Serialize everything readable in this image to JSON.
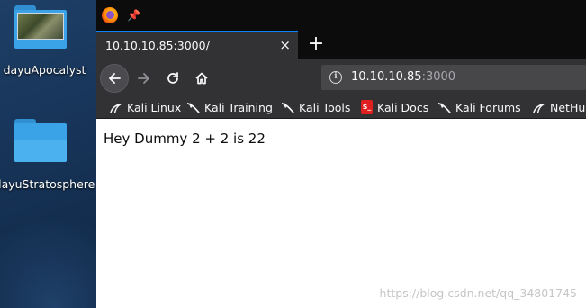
{
  "desktop": {
    "icons": [
      {
        "label": "dayuApocalyst"
      },
      {
        "label": "dayuStratosphere"
      }
    ]
  },
  "browser": {
    "tab": {
      "title": "10.10.10.85:3000/",
      "close_glyph": "×"
    },
    "new_tab_glyph": "+",
    "address": {
      "host": "10.10.10.85",
      "port": ":3000"
    },
    "bookmarks": [
      {
        "label": "Kali Linux",
        "icon": "kali-dragon-icon"
      },
      {
        "label": "Kali Training",
        "icon": "kali-dragon-icon"
      },
      {
        "label": "Kali Tools",
        "icon": "kali-dragon-icon"
      },
      {
        "label": "Kali Docs",
        "icon": "kali-docs-icon"
      },
      {
        "label": "Kali Forums",
        "icon": "kali-dragon-icon"
      },
      {
        "label": "NetHu",
        "icon": "kali-dragon-icon"
      }
    ]
  },
  "page": {
    "text": "Hey Dummy 2 + 2 is 22"
  },
  "watermark": "https://blog.csdn.net/qq_34801745",
  "colors": {
    "tab_accent": "#0a84ff",
    "toolbar": "#323234",
    "titlebar": "#0c0c0d",
    "folder": "#3aa2e6"
  }
}
